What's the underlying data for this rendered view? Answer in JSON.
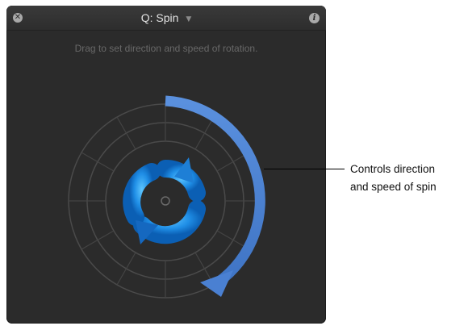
{
  "hud": {
    "title": "Q: Spin",
    "title_menu_icon": "triangle-down",
    "close_icon": "close-x",
    "info_icon": "info-i",
    "instructions": "Drag to set direction and speed of rotation.",
    "spin_icon": "circular-arrows",
    "direction_arrow_icon": "clockwise-arc-arrow",
    "accent_color": "#4f86d6"
  },
  "callout": {
    "line1": "Controls direction",
    "line2": "and speed of spin"
  }
}
